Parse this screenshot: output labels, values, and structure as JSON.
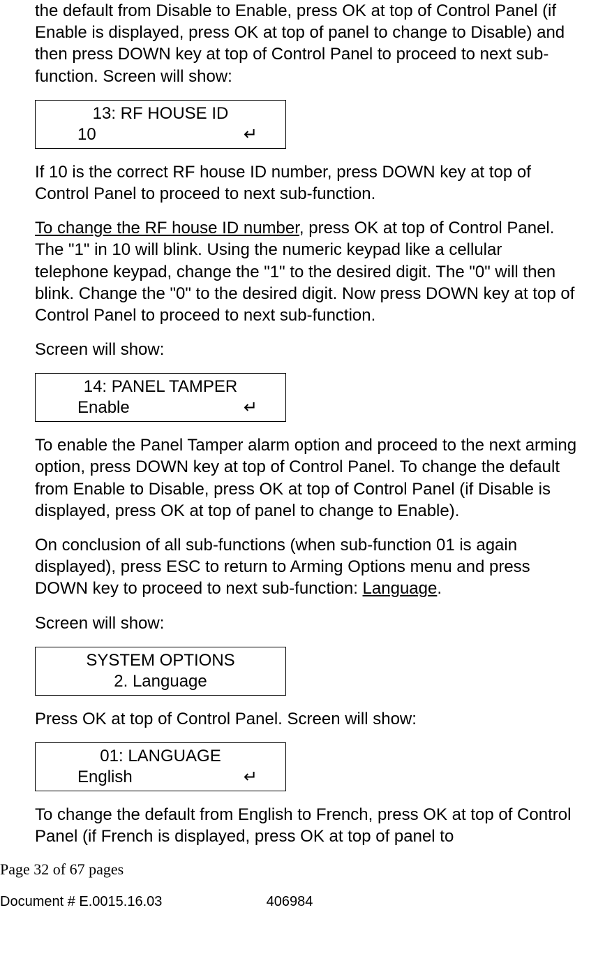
{
  "para1": "the default from Disable to Enable, press OK at top of Control Panel (if Enable is displayed, press OK at top of panel to change to Disable) and then press DOWN key at top of Control Panel to proceed to next sub-function. Screen will show:",
  "lcd1": {
    "line1": "13: RF HOUSE ID",
    "line2_left": "10",
    "line2_right": "↵"
  },
  "para2": "If 10 is the correct RF house ID number, press DOWN key at top of Control Panel to proceed to next sub-function.",
  "para3_underline": "To change the RF house ID number",
  "para3_rest": ", press OK at top of Control Panel. The \"1\" in 10 will blink. Using the numeric keypad like a cellular telephone keypad, change the \"1\" to the desired digit. The \"0\" will then blink. Change the \"0\" to the desired digit. Now press DOWN key at top of Control Panel to proceed to next sub-function.",
  "para4": "Screen will show:",
  "lcd2": {
    "line1": "14: PANEL TAMPER",
    "line2_left": "Enable",
    "line2_right": "↵"
  },
  "para5": "To enable the Panel Tamper alarm option and proceed to the next arming option, press DOWN key at top of Control Panel. To change the default from Enable to Disable, press OK at top of Control Panel (if Disable is displayed, press OK at top of panel to change to Enable).",
  "para6_a": "On conclusion of all sub-functions (when sub-function 01 is again displayed), press ESC to return to Arming Options menu and press DOWN key to proceed to next sub-function: ",
  "para6_underline": "Language",
  "para6_b": ".",
  "para7": "Screen will show:",
  "lcd3": {
    "line1": "SYSTEM OPTIONS",
    "line2": "2. Language"
  },
  "para8": "Press OK at top of Control Panel. Screen will show:",
  "lcd4": {
    "line1": "01: LANGUAGE",
    "line2_left": "English",
    "line2_right": "↵"
  },
  "para9": "To change the default from English to French, press OK at top of Control Panel (if French is displayed, press OK at top of panel to",
  "footer_page": "Page 32 of  67 pages",
  "footer_doc_left": "Document # E.0015.16.03",
  "footer_doc_center": "406984"
}
